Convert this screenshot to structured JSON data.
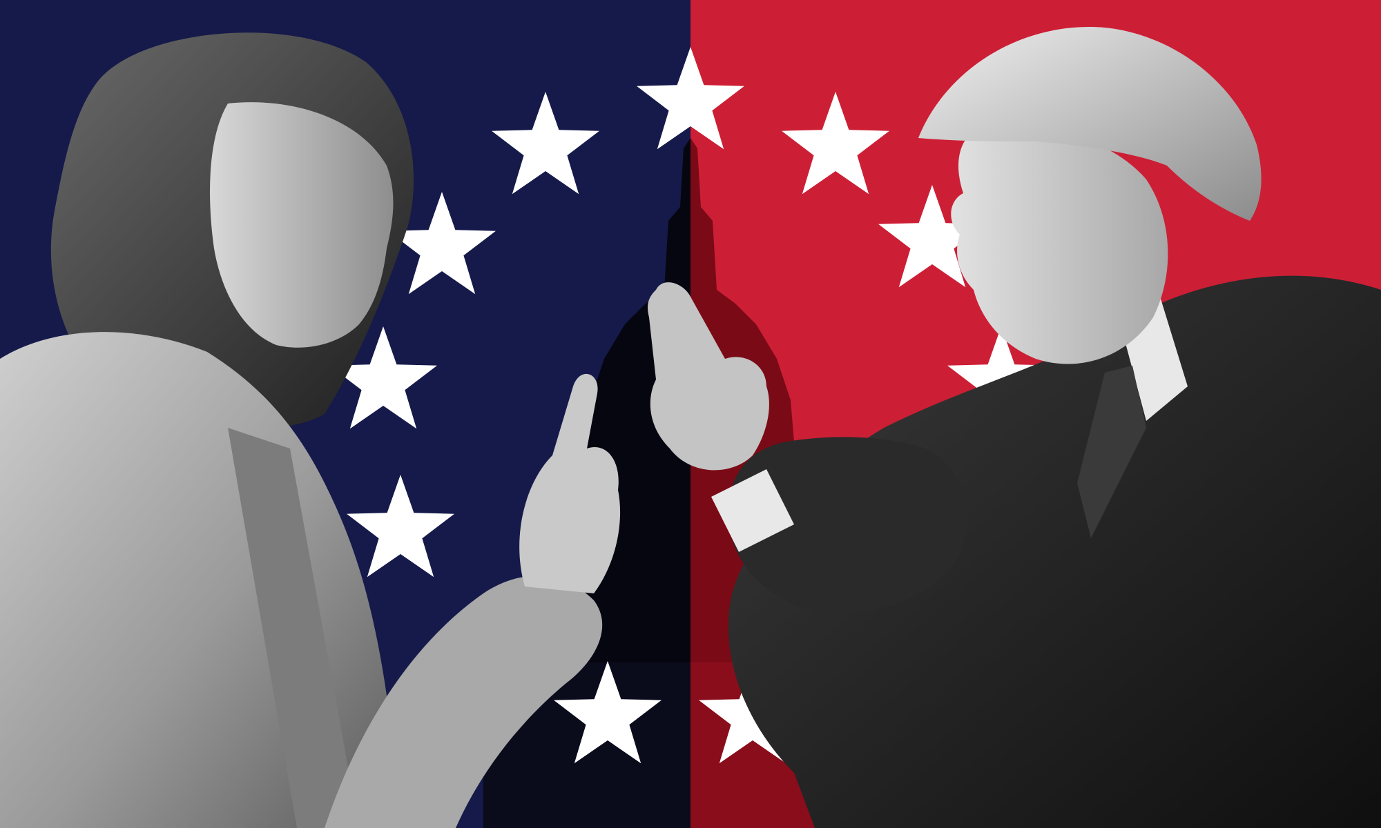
{
  "image": {
    "description_visible_text": [],
    "colors": {
      "left_background": "#151a4a",
      "right_background": "#cc1f35",
      "star": "#ffffff",
      "capitol_left": "#05060f",
      "capitol_right": "#7a0a16",
      "figure_light": "#b9b9b9",
      "figure_mid": "#7d7d7d",
      "figure_dark": "#2a2a2a",
      "suit_dark": "#1b1b1b",
      "shirt": "#e8e8e8"
    }
  }
}
